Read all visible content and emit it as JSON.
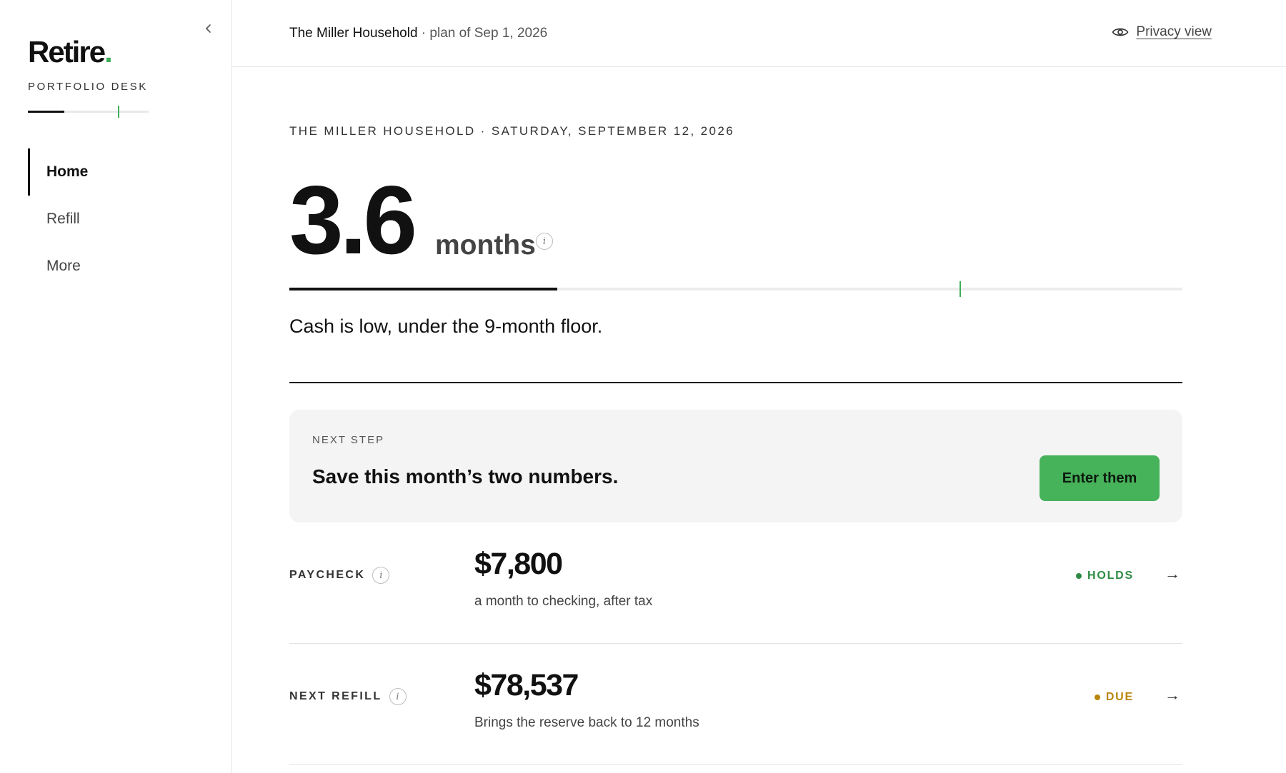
{
  "sidebar": {
    "logo_word": "Retire",
    "logo_dot": ".",
    "logo_subtitle": "PORTFOLIO DESK",
    "nav": [
      {
        "label": "Home",
        "active": true
      },
      {
        "label": "Refill",
        "active": false
      },
      {
        "label": "More",
        "active": false
      }
    ]
  },
  "header": {
    "household": "The Miller Household",
    "plan": " · plan of Sep 1, 2026",
    "privacy_label": "Privacy view"
  },
  "main": {
    "dateline": "THE MILLER HOUSEHOLD · SATURDAY, SEPTEMBER 12, 2026",
    "reserve_value": "3.6",
    "reserve_unit": "months",
    "reserve_months": 3.6,
    "floor_months": 9,
    "scale_max_months": 12,
    "status_text": "Cash is low, under the 9-month floor."
  },
  "next_step": {
    "kicker": "NEXT STEP",
    "title": "Save this month’s two numbers.",
    "button_label": "Enter them"
  },
  "metrics": [
    {
      "label": "PAYCHECK",
      "value": "$7,800",
      "caption": "a month to checking, after tax",
      "status": "HOLDS",
      "status_color": "#2e8b44"
    },
    {
      "label": "NEXT REFILL",
      "value": "$78,537",
      "caption": "Brings the reserve back to 12 months",
      "status": "DUE",
      "status_color": "#b8860b"
    }
  ],
  "colors": {
    "accent": "#46b25a",
    "holds": "#2e8b44",
    "due": "#b8860b"
  },
  "icons": {
    "collapse": "chevron-left-icon",
    "privacy": "eye-icon",
    "info": "info-icon",
    "arrow": "arrow-right-icon"
  }
}
